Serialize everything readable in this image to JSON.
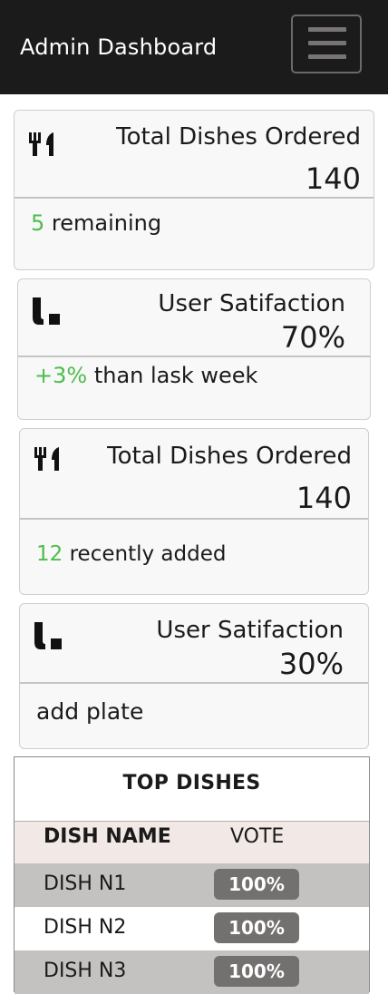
{
  "app": {
    "title": "Admin Dashboard",
    "menu_icon": "hamburger-icon"
  },
  "cards": [
    {
      "icon": "utensils-icon",
      "title": "Total Dishes Ordered",
      "value": "140",
      "highlight": "5",
      "footer": " remaining"
    },
    {
      "icon": "chart-icon",
      "title": "User Satifaction",
      "value": "70%",
      "highlight": "+3%",
      "footer": " than lask week"
    },
    {
      "icon": "utensils-icon",
      "title": "Total Dishes Ordered",
      "value": "140",
      "highlight": "12",
      "footer": " recently added"
    },
    {
      "icon": "chart-icon",
      "title": "User Satifaction",
      "value": "30%",
      "highlight": "",
      "footer": "add plate"
    }
  ],
  "top_dishes": {
    "title": "TOP DISHES",
    "columns": [
      "DISH NAME",
      "VOTE"
    ],
    "rows": [
      {
        "name": "DISH N1",
        "vote": "100%"
      },
      {
        "name": "DISH N2",
        "vote": "100%"
      },
      {
        "name": "DISH N3",
        "vote": "100%"
      }
    ]
  },
  "colors": {
    "topbar": "#1c1b1b",
    "accent_green": "#4cbd4c",
    "pill": "#737070",
    "row_odd": "#c4c2c0",
    "row_even": "#ffffff",
    "header_row": "#f2e8e6"
  }
}
